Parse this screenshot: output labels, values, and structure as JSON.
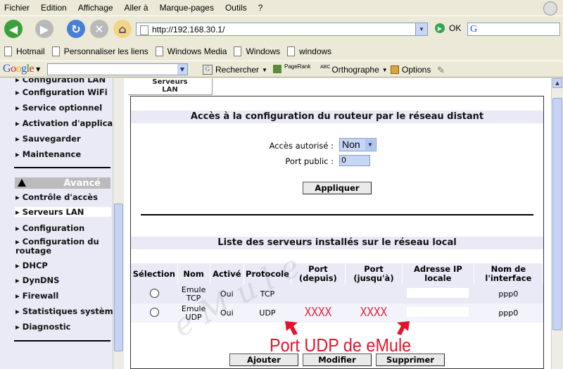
{
  "menu": [
    "Fichier",
    "Edition",
    "Affichage",
    "Aller à",
    "Marque-pages",
    "Outils",
    "?"
  ],
  "nav": {
    "url": "http://192.168.30.1/",
    "go_label": "OK",
    "search_glyph": "G"
  },
  "bookmarks": [
    "Hotmail",
    "Personnaliser les liens",
    "Windows Media",
    "Windows",
    "windows"
  ],
  "google_bar": {
    "logo": "Google",
    "search_label": "Rechercher",
    "pagerank_label": "PageRank",
    "spell_label": "ABC",
    "spell_text": "Orthographe",
    "options_label": "Options"
  },
  "sidebar": {
    "items_top": [
      "Configuration LAN",
      "Configuration WiFi",
      "Service optionnel",
      "Activation d'applica",
      "Sauvegarder",
      "Maintenance"
    ],
    "section_label": "Avancé",
    "items_adv": [
      "Contrôle d'accès",
      "Serveurs LAN",
      "Configuration",
      "Configuration du routage",
      "DHCP",
      "DynDNS",
      "Firewall",
      "Statistiques systèm",
      "Diagnostic"
    ],
    "selected": "Serveurs LAN"
  },
  "tab": {
    "label": "Serveurs LAN"
  },
  "remote": {
    "title": "Accès à la configuration du routeur par le réseau distant",
    "access_label": "Accès autorisé :",
    "access_value": "Non",
    "port_label": "Port public :",
    "port_value": "0",
    "apply_label": "Appliquer"
  },
  "servers": {
    "title": "Liste des serveurs installés sur le réseau local",
    "columns": [
      "Sélection",
      "Nom",
      "Activé",
      "Protocole",
      "Port (depuis)",
      "Port (jusqu'à)",
      "Adresse IP locale",
      "Nom de l'interface"
    ],
    "rows": [
      {
        "name": "Emule TCP",
        "enabled": "Oui",
        "protocol": "TCP",
        "port_from": "",
        "port_to": "",
        "ip": "",
        "iface": "ppp0"
      },
      {
        "name": "Emule UDP",
        "enabled": "Oui",
        "protocol": "UDP",
        "port_from": "XXXX",
        "port_to": "XXXX",
        "ip": "",
        "iface": "ppp0"
      }
    ],
    "add_label": "Ajouter",
    "edit_label": "Modifier",
    "delete_label": "Supprimer"
  },
  "annotation": "Port UDP de eMule",
  "colors": {
    "annotation": "#e3152b",
    "panel_bg": "#eaeaf7"
  }
}
